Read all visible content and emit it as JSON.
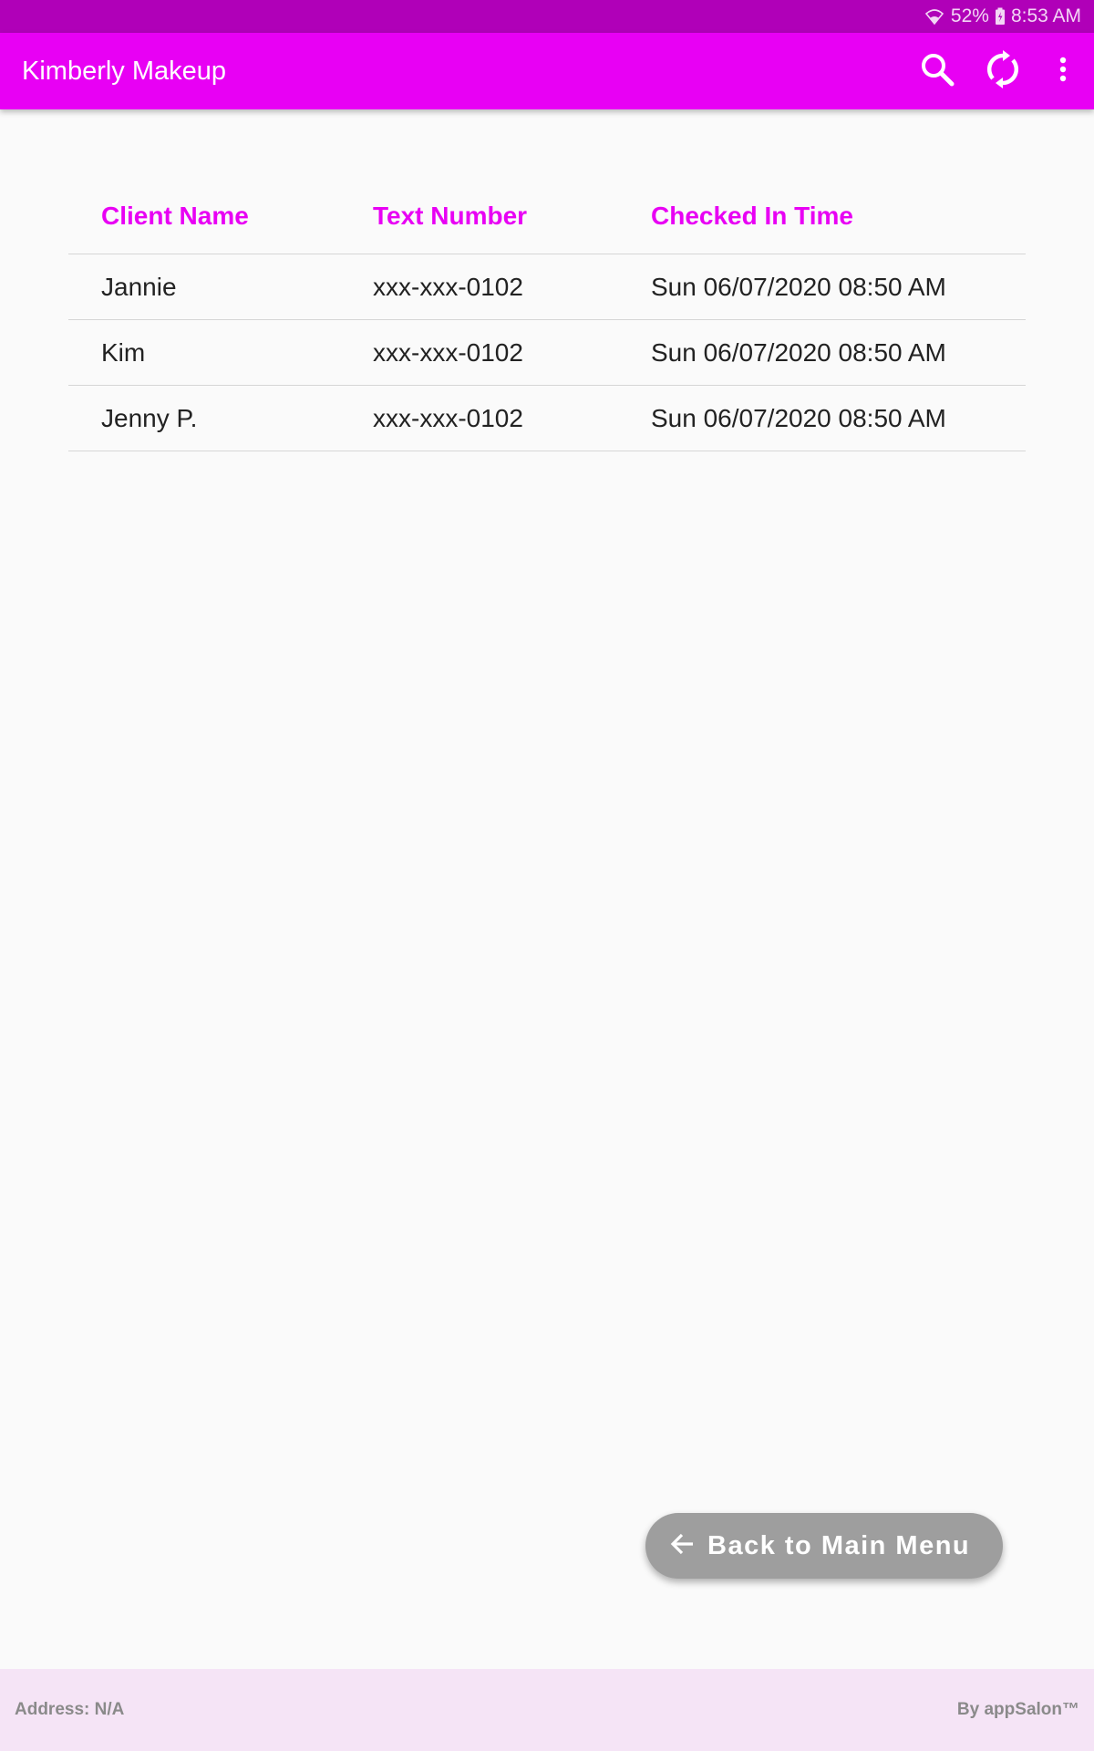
{
  "status_bar": {
    "battery": "52%",
    "time": "8:53 AM"
  },
  "app_bar": {
    "title": "Kimberly Makeup",
    "icons": [
      "search-icon",
      "sync-icon",
      "more-vert-icon"
    ]
  },
  "table": {
    "headers": {
      "client_name": "Client Name",
      "text_number": "Text Number",
      "checked_in_time": "Checked In Time"
    },
    "rows": [
      {
        "client_name": "Jannie",
        "text_number": "xxx-xxx-0102",
        "checked_in_time": "Sun 06/07/2020 08:50 AM"
      },
      {
        "client_name": "Kim",
        "text_number": "xxx-xxx-0102",
        "checked_in_time": "Sun 06/07/2020 08:50 AM"
      },
      {
        "client_name": "Jenny P.",
        "text_number": "xxx-xxx-0102",
        "checked_in_time": "Sun 06/07/2020 08:50 AM"
      }
    ]
  },
  "fab": {
    "label": "Back to Main Menu",
    "icon": "arrow-back-icon"
  },
  "footer": {
    "address": "Address: N/A",
    "credit": "By appSalon™"
  },
  "colors": {
    "primary": "#e800f4",
    "primary_dark": "#b000b8",
    "fab": "#9e9e9e",
    "footer_bg": "#f5e4f6"
  }
}
